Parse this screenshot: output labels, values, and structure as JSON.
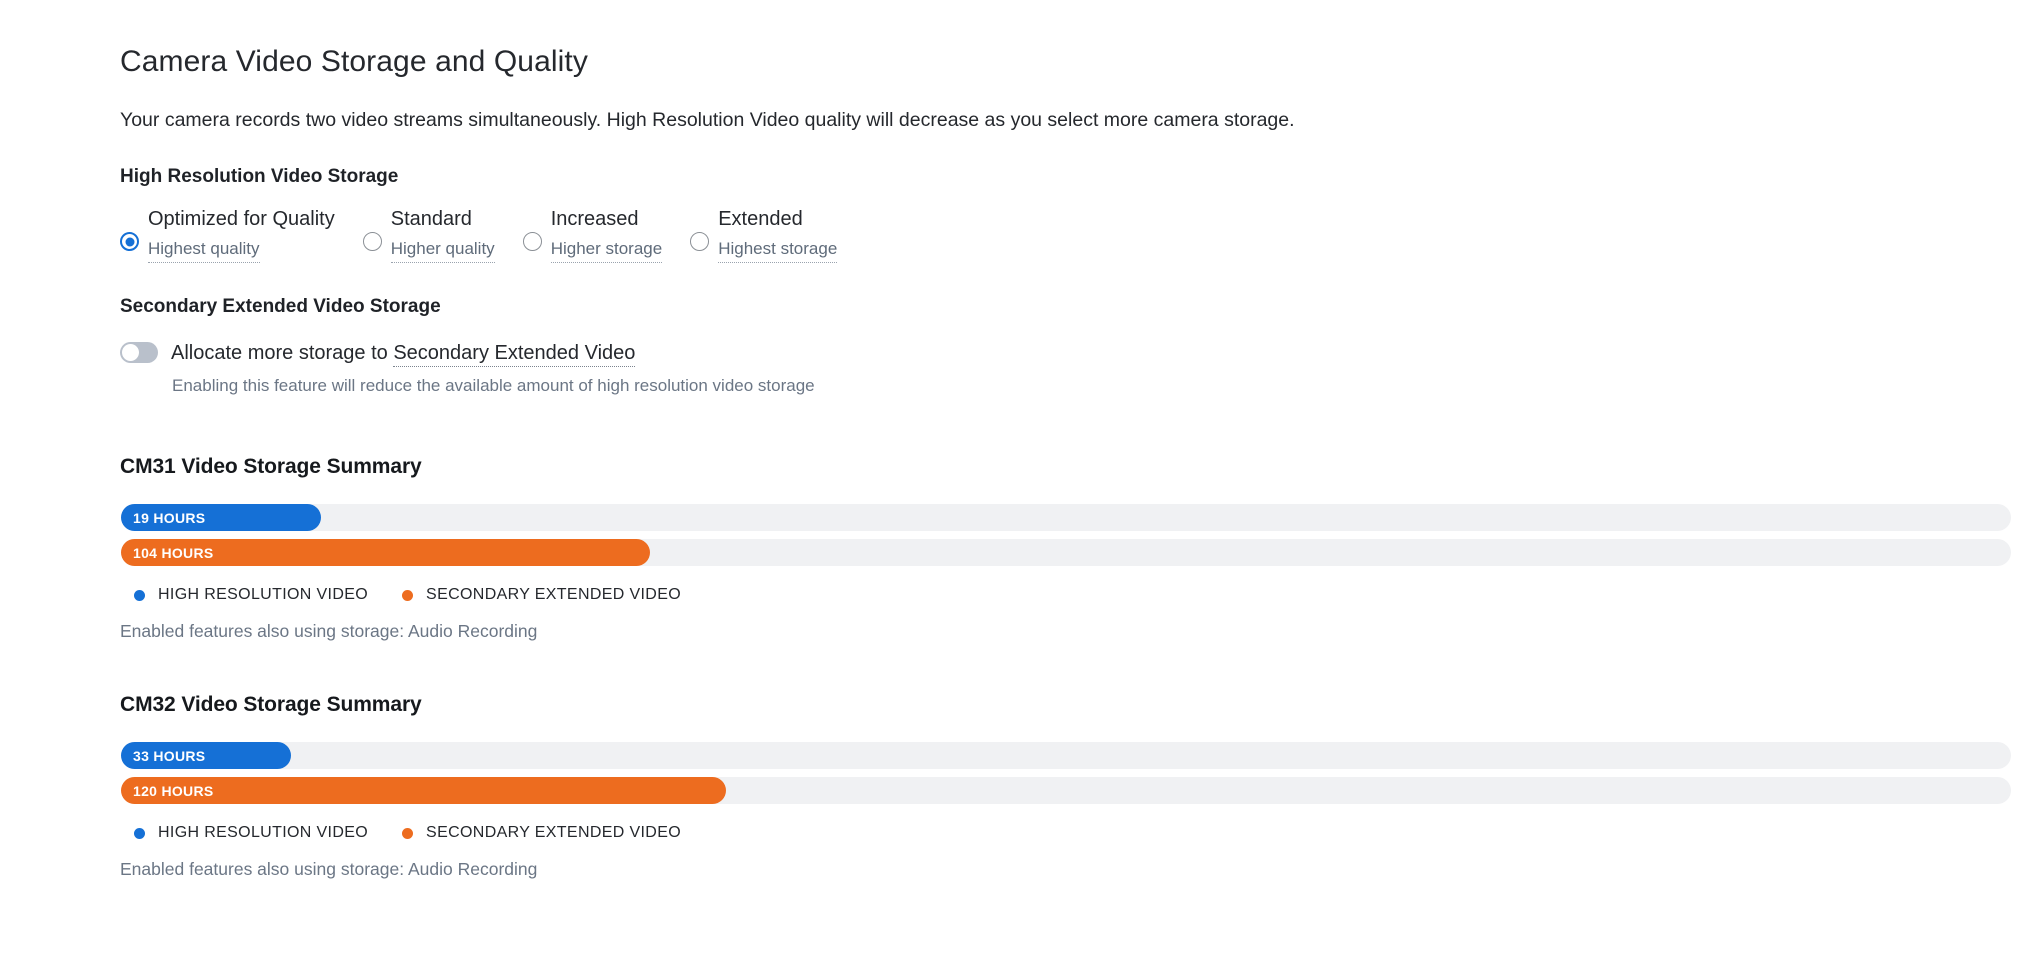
{
  "header": {
    "title": "Camera Video Storage and Quality",
    "description": "Your camera records two video streams simultaneously. High Resolution Video quality will decrease as you select more camera storage."
  },
  "high_resolution_video_storage": {
    "label": "High Resolution Video Storage",
    "selected": "Optimized for Quality",
    "options": [
      {
        "label": "Optimized for Quality",
        "sublabel": "Highest quality",
        "checked": true
      },
      {
        "label": "Standard",
        "sublabel": "Higher quality",
        "checked": false
      },
      {
        "label": "Increased",
        "sublabel": "Higher storage",
        "checked": false
      },
      {
        "label": "Extended",
        "sublabel": "Highest storage",
        "checked": false
      }
    ]
  },
  "secondary_extended_video_storage": {
    "label": "Secondary Extended Video Storage",
    "toggle_state": "off",
    "toggle_label_prefix": "Allocate more storage to ",
    "toggle_label_link": "Secondary Extended Video",
    "help_text": "Enabling this feature will reduce the available amount of high resolution video storage"
  },
  "legend": {
    "high_resolution": "HIGH RESOLUTION VIDEO",
    "secondary_extended": "SECONDARY EXTENDED VIDEO"
  },
  "summaries": [
    {
      "title": "CM31 Video Storage Summary",
      "high_resolution_value": "19 HOURS",
      "secondary_extended_value": "104 HOURS",
      "enabled_note": "Enabled features also using storage: Audio Recording"
    },
    {
      "title": "CM32 Video Storage Summary",
      "high_resolution_value": "33 HOURS",
      "secondary_extended_value": "120 HOURS",
      "enabled_note": "Enabled features also using storage: Audio Recording"
    }
  ],
  "colors": {
    "high_resolution": "#1570d6",
    "secondary_extended": "#ed6c1f",
    "track": "#f0f1f3",
    "toggle_off": "#b9c0cb"
  },
  "chart_data": {
    "type": "bar",
    "title": "Video Storage Summary",
    "orientation": "horizontal",
    "unit": "hours",
    "axis_max_hours": 180,
    "series": [
      {
        "name": "HIGH RESOLUTION VIDEO",
        "color": "#1570d6",
        "values": [
          19,
          33
        ]
      },
      {
        "name": "SECONDARY EXTENDED VIDEO",
        "color": "#ed6c1f",
        "values": [
          104,
          120
        ]
      }
    ],
    "categories": [
      "CM31",
      "CM32"
    ],
    "bars": [
      {
        "camera": "CM31",
        "series": "HIGH RESOLUTION VIDEO",
        "value": 19,
        "label": "19 HOURS",
        "pct": 10.6
      },
      {
        "camera": "CM31",
        "series": "SECONDARY EXTENDED VIDEO",
        "value": 104,
        "label": "104 HOURS",
        "pct": 28.0
      },
      {
        "camera": "CM32",
        "series": "HIGH RESOLUTION VIDEO",
        "value": 33,
        "label": "33 HOURS",
        "pct": 9.0
      },
      {
        "camera": "CM32",
        "series": "SECONDARY EXTENDED VIDEO",
        "value": 120,
        "label": "120 HOURS",
        "pct": 32.0
      }
    ],
    "legend_position": "below",
    "grid": false,
    "xlabel": "",
    "ylabel": ""
  }
}
